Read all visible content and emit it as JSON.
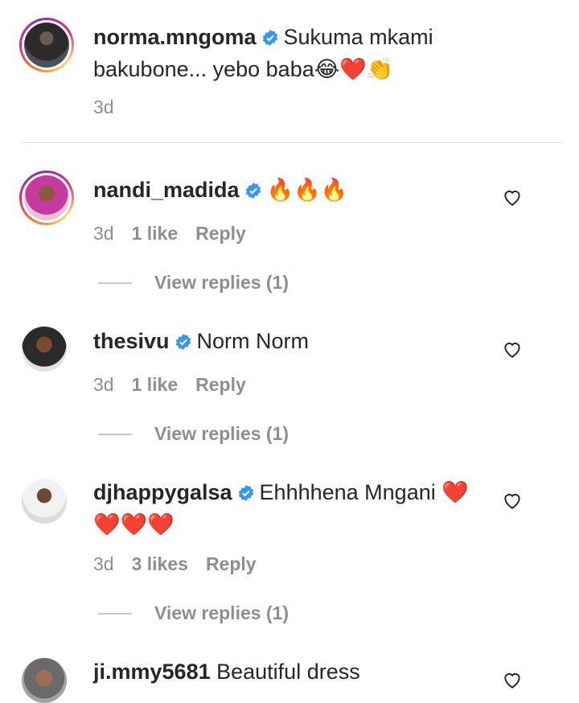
{
  "comments": [
    {
      "username": "norma.mngoma",
      "text": "Sukuma mkami bakubone... yebo baba😂❤️👏",
      "time": "3d",
      "likes": "",
      "reply": ""
    },
    {
      "username": "nandi_madida",
      "text": "🔥🔥🔥",
      "time": "3d",
      "likes": "1 like",
      "reply": "Reply",
      "view_replies": "View replies (1)"
    },
    {
      "username": "thesivu",
      "text": "Norm Norm",
      "time": "3d",
      "likes": "1 like",
      "reply": "Reply",
      "view_replies": "View replies (1)"
    },
    {
      "username": "djhappygalsa",
      "text": "Ehhhhena Mngani ❤️❤️❤️❤️",
      "time": "3d",
      "likes": "3 likes",
      "reply": "Reply",
      "view_replies": "View replies (1)"
    },
    {
      "username": "ji.mmy5681",
      "text": "Beautiful dress"
    }
  ],
  "colors": {
    "verified": "#3897f0",
    "muted": "#8e8e8e",
    "text": "#262626"
  }
}
